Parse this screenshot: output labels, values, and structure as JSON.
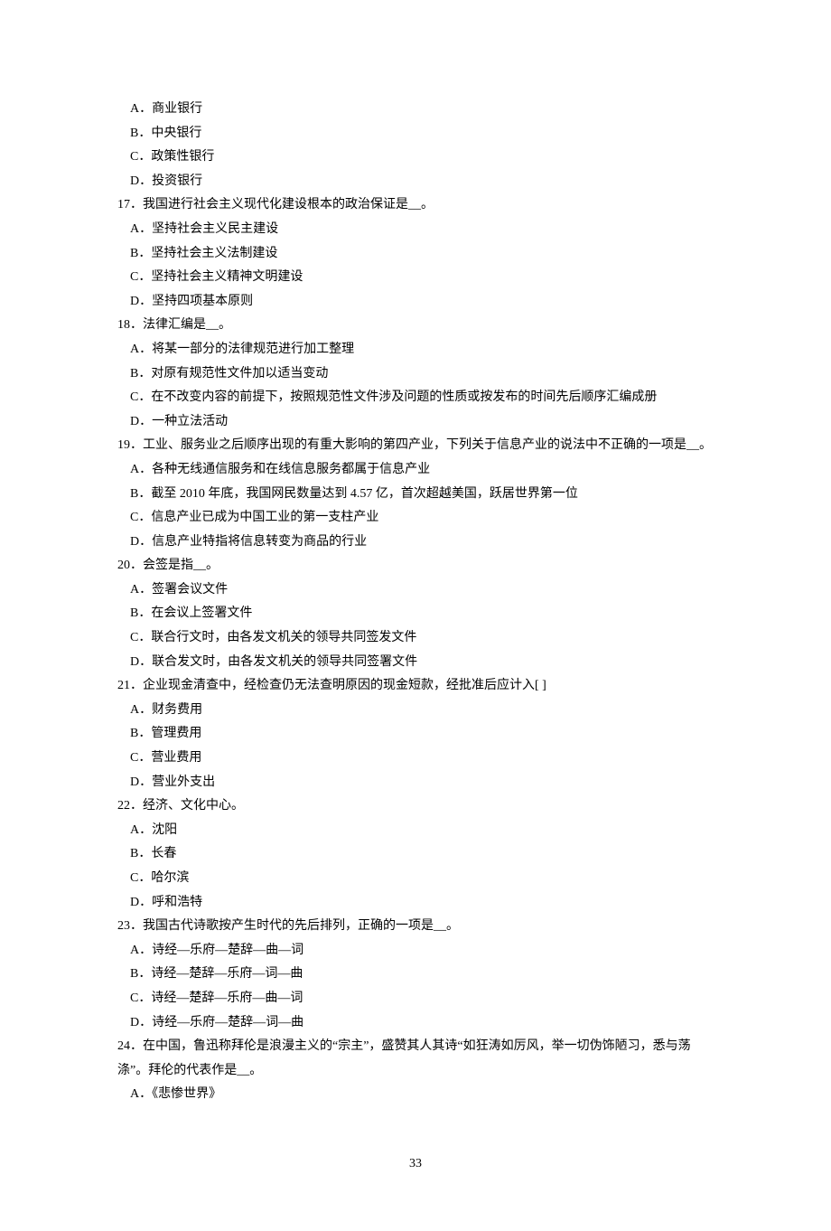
{
  "lines": [
    "A．商业银行",
    "B．中央银行",
    "C．政策性银行",
    "D．投资银行",
    "17．我国进行社会主义现代化建设根本的政治保证是__。",
    "A．坚持社会主义民主建设",
    "B．坚持社会主义法制建设",
    "C．坚持社会主义精神文明建设",
    "D．坚持四项基本原则",
    "18．法律汇编是__。",
    "A．将某一部分的法律规范进行加工整理",
    "B．对原有规范性文件加以适当变动",
    "C．在不改变内容的前提下，按照规范性文件涉及问题的性质或按发布的时间先后顺序汇编成册",
    "D．一种立法活动",
    "19．工业、服务业之后顺序出现的有重大影响的第四产业，下列关于信息产业的说法中不正确的一项是__。",
    "A．各种无线通信服务和在线信息服务都属于信息产业",
    "B．截至 2010 年底，我国网民数量达到 4.57 亿，首次超越美国，跃居世界第一位",
    "C．信息产业已成为中国工业的第一支柱产业",
    "D．信息产业特指将信息转变为商品的行业",
    "20．会签是指__。",
    "A．签署会议文件",
    "B．在会议上签署文件",
    "C．联合行文时，由各发文机关的领导共同签发文件",
    "D．联合发文时，由各发文机关的领导共同签署文件",
    "21．企业现金清查中，经检查仍无法查明原因的现金短款，经批准后应计入[  ]",
    "A．财务费用",
    "B．管理费用",
    "C．营业费用",
    "D．营业外支出",
    "22．经济、文化中心。",
    "A．沈阳",
    "B．长春",
    "C．哈尔滨",
    "D．呼和浩特",
    "23．我国古代诗歌按产生时代的先后排列，正确的一项是__。",
    "A．诗经—乐府—楚辞—曲—词",
    "B．诗经—楚辞—乐府—词—曲",
    "C．诗经—楚辞—乐府—曲—词",
    "D．诗经—乐府—楚辞—词—曲",
    "24．在中国，鲁迅称拜伦是浪漫主义的“宗主”，盛赞其人其诗“如狂涛如厉风，举一切伪饰陋习，悉与荡涤”。拜伦的代表作是__。",
    "A．《悲惨世界》"
  ],
  "indentFlags": [
    true,
    true,
    true,
    true,
    false,
    true,
    true,
    true,
    true,
    false,
    true,
    true,
    true,
    true,
    false,
    true,
    true,
    true,
    true,
    false,
    true,
    true,
    true,
    true,
    false,
    true,
    true,
    true,
    true,
    false,
    true,
    true,
    true,
    true,
    false,
    true,
    true,
    true,
    true,
    false,
    true
  ],
  "pageNumber": "33"
}
